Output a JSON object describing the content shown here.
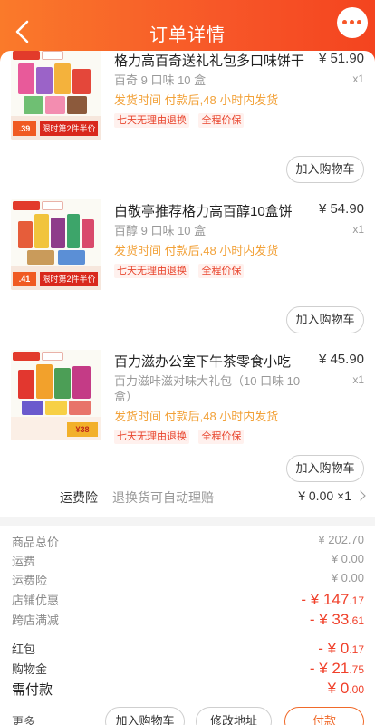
{
  "header": {
    "title": "订单详情",
    "back_icon": "chevron-left-icon",
    "more_icon": "more-dots-icon"
  },
  "products": [
    {
      "name": "格力高百奇送礼礼包多口味饼干",
      "spec": "百奇 9 口味 10 盒",
      "delivery": "发货时间  付款后,48 小时内发货",
      "badges": [
        "七天无理由退换",
        "全程价保"
      ],
      "price": "¥ 51.90",
      "qty": "x1",
      "button": "加入购物车",
      "thumb_price": ".39",
      "thumb_promo": "限时第2件半价"
    },
    {
      "name": "白敬亭推荐格力高百醇10盒饼",
      "spec": "百醇 9 口味 10 盒",
      "delivery": "发货时间  付款后,48 小时内发货",
      "badges": [
        "七天无理由退换",
        "全程价保"
      ],
      "price": "¥ 54.90",
      "qty": "x1",
      "button": "加入购物车",
      "thumb_price": ".41",
      "thumb_promo": "限时第2件半价"
    },
    {
      "name": "百力滋办公室下午茶零食小吃",
      "spec": "百力滋咔滋对味大礼包（10 口味 10 盒）",
      "delivery": "发货时间  付款后,48 小时内发货",
      "badges": [
        "七天无理由退换",
        "全程价保"
      ],
      "price": "¥ 45.90",
      "qty": "x1",
      "button": "加入购物车",
      "thumb_price": "¥38",
      "thumb_promo": ""
    }
  ],
  "insurance": {
    "label": "运费险",
    "desc": "退换货可自动理赔",
    "value": "¥ 0.00 ×1"
  },
  "summary": [
    {
      "label": "商品总价",
      "value": "¥ 202.70",
      "style": "gray"
    },
    {
      "label": "运费",
      "value": "¥ 0.00",
      "style": "gray"
    },
    {
      "label": "运费险",
      "value": "¥ 0.00",
      "style": "gray"
    },
    {
      "label": "店铺优惠",
      "value_main": "- ¥ 147",
      "value_dec": ".17",
      "style": "red"
    },
    {
      "label": "跨店满减",
      "value_main": "- ¥ 33",
      "value_dec": ".61",
      "style": "red"
    },
    {
      "label": "红包",
      "value_main": "- ¥ 0",
      "value_dec": ".17",
      "style": "red"
    },
    {
      "label": "购物金",
      "value_main": "- ¥ 21",
      "value_dec": ".75",
      "style": "red"
    },
    {
      "label": "需付款",
      "value_main": "¥ 0",
      "value_dec": ".00",
      "style": "red"
    }
  ],
  "bottom": {
    "more": "更多",
    "cart": "加入购物车",
    "address": "修改地址",
    "pay": "付款"
  },
  "colors": {
    "header_start": "#fa7a2a",
    "header_end": "#f4441f",
    "delivery": "#f2a23a",
    "discount": "#f0402a"
  }
}
